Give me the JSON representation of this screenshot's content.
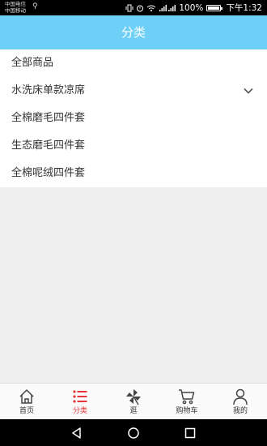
{
  "status_bar": {
    "carrier_1": "中国电信",
    "carrier_2": "中国移动",
    "battery": "100%",
    "time": "下午1:32",
    "icons": [
      "usb-icon",
      "vibrate-icon",
      "alarm-icon",
      "wifi-icon",
      "signal-icon",
      "battery-icon"
    ]
  },
  "header": {
    "title": "分类"
  },
  "categories": [
    {
      "label": "全部商品",
      "expandable": false
    },
    {
      "label": "水洗床单款凉席",
      "expandable": true
    },
    {
      "label": "全棉磨毛四件套",
      "expandable": false
    },
    {
      "label": "生态磨毛四件套",
      "expandable": false
    },
    {
      "label": "全棉呢绒四件套",
      "expandable": false
    }
  ],
  "tabs": [
    {
      "label": "首页",
      "icon": "home-icon",
      "active": false
    },
    {
      "label": "分类",
      "icon": "category-list-icon",
      "active": true
    },
    {
      "label": "逛",
      "icon": "pinwheel-icon",
      "active": false
    },
    {
      "label": "购物车",
      "icon": "cart-icon",
      "active": false
    },
    {
      "label": "我的",
      "icon": "user-icon",
      "active": false
    }
  ],
  "colors": {
    "header_bg": "#6ed0f7",
    "active_tab": "#e8363e"
  },
  "nav_icons": [
    "back-icon",
    "home-circle-icon",
    "recents-icon"
  ]
}
